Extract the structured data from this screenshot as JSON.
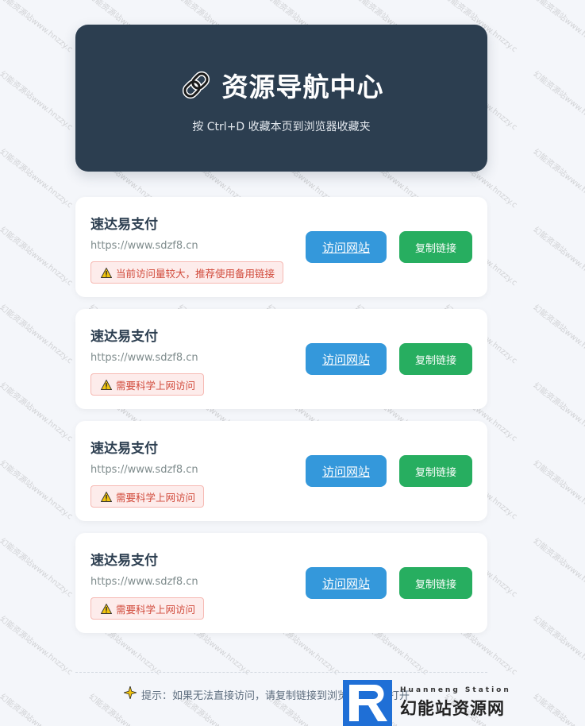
{
  "header": {
    "title": "资源导航中心",
    "subtitle": "按 Ctrl+D 收藏本页到浏览器收藏夹",
    "icon": "link-icon"
  },
  "cards": [
    {
      "name": "速达易支付",
      "url": "https://www.sdzf8.cn",
      "warning": "当前访问量较大，推荐使用备用链接",
      "visit_label": "访问网站",
      "copy_label": "复制链接"
    },
    {
      "name": "速达易支付",
      "url": "https://www.sdzf8.cn",
      "warning": "需要科学上网访问",
      "visit_label": "访问网站",
      "copy_label": "复制链接"
    },
    {
      "name": "速达易支付",
      "url": "https://www.sdzf8.cn",
      "warning": "需要科学上网访问",
      "visit_label": "访问网站",
      "copy_label": "复制链接"
    },
    {
      "name": "速达易支付",
      "url": "https://www.sdzf8.cn",
      "warning": "需要科学上网访问",
      "visit_label": "访问网站",
      "copy_label": "复制链接"
    }
  ],
  "footer": {
    "tip": "提示：如果无法直接访问，请复制链接到浏览器地址栏打开",
    "tip_icon": "sparkle-icon"
  },
  "watermark": {
    "text": "幻能资源站www.hnzzy.c"
  },
  "logo": {
    "en": "Huanneng Station",
    "cn": "幻能站资源网"
  },
  "colors": {
    "header_bg": "#2c3e50",
    "visit_button": "#3498db",
    "copy_button": "#27ae60",
    "warning_text": "#d14b3c",
    "warning_bg": "#fdeceb"
  }
}
